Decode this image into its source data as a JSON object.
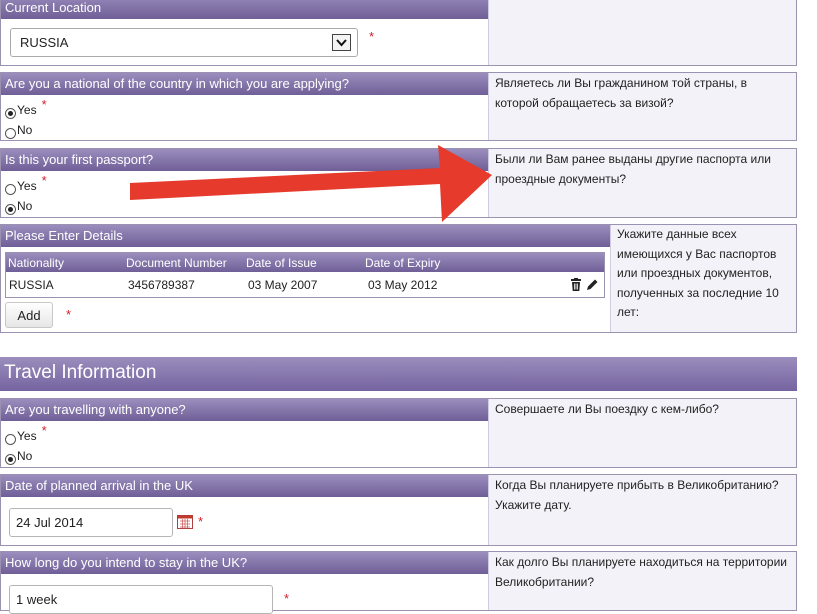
{
  "current_location": {
    "label": "Current Location",
    "selected": "RUSSIA"
  },
  "national": {
    "question": "Are you a national of the country in which you are applying?",
    "help": "Являетесь ли Вы гражданином той страны, в которой обращаетесь за визой?",
    "options": [
      "Yes",
      "No"
    ],
    "selected": "Yes"
  },
  "first_passport": {
    "question": "Is this your first passport?",
    "help": "Были ли Вам ранее выданы другие паспорта или проездные документы?",
    "options": [
      "Yes",
      "No"
    ],
    "selected": "No"
  },
  "details": {
    "label": "Please Enter Details",
    "help": "Укажите данные всех имеющихся у Вас паспортов или проездных документов, полученных за последние 10 лет:",
    "columns": [
      "Nationality",
      "Document Number",
      "Date of Issue",
      "Date of Expiry"
    ],
    "row": [
      "RUSSIA",
      "3456789387",
      "03 May 2007",
      "03 May 2012"
    ],
    "add_label": "Add"
  },
  "travel": {
    "title": "Travel Information"
  },
  "travelling_with": {
    "question": "Are you travelling with anyone?",
    "help": "Совершаете ли Вы поездку с кем-либо?",
    "options": [
      "Yes",
      "No"
    ],
    "selected": "No"
  },
  "arrival": {
    "question": "Date of planned arrival in the UK",
    "help": "Когда Вы планируете прибыть в Великобританию? Укажите дату.",
    "value": "24 Jul 2014"
  },
  "stay": {
    "question": "How long do you intend to stay in the UK?",
    "help": "Как долго Вы планируете находиться на территории Великобритании?",
    "value": "1 week"
  },
  "required_mark": "*",
  "colors": {
    "header_top": "#9b8dbd",
    "header_bottom": "#6f5f97",
    "required": "#d0202a",
    "arrow": "#e53a2c"
  },
  "icons": [
    "chevron-down-icon",
    "trash-icon",
    "pencil-icon",
    "calendar-icon"
  ]
}
